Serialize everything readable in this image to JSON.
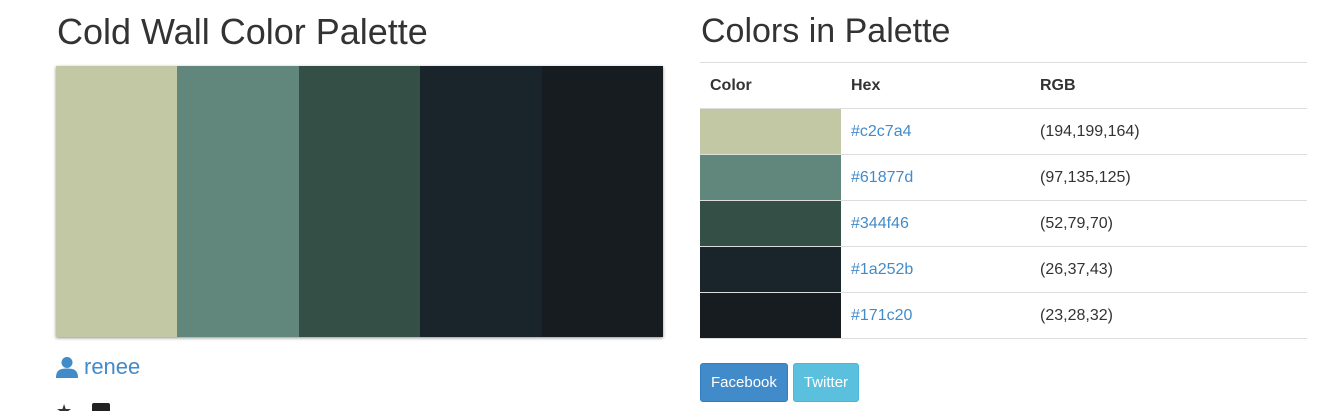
{
  "palette_title": "Cold Wall Color Palette",
  "author": {
    "name": "renee",
    "icon": "user-icon"
  },
  "swatches": [
    "#c2c7a4",
    "#61877d",
    "#344f46",
    "#1a252b",
    "#171c20"
  ],
  "table": {
    "title": "Colors in Palette",
    "headers": {
      "color": "Color",
      "hex": "Hex",
      "rgb": "RGB"
    },
    "rows": [
      {
        "color": "#c2c7a4",
        "hex": "#c2c7a4",
        "rgb": "(194,199,164)"
      },
      {
        "color": "#61877d",
        "hex": "#61877d",
        "rgb": "(97,135,125)"
      },
      {
        "color": "#344f46",
        "hex": "#344f46",
        "rgb": "(52,79,70)"
      },
      {
        "color": "#1a252b",
        "hex": "#1a252b",
        "rgb": "(26,37,43)"
      },
      {
        "color": "#171c20",
        "hex": "#171c20",
        "rgb": "(23,28,32)"
      }
    ]
  },
  "share": {
    "facebook_label": "Facebook",
    "twitter_label": "Twitter"
  },
  "colors": {
    "link": "#428bca",
    "facebook": "#428bca",
    "twitter": "#5bc0de"
  }
}
